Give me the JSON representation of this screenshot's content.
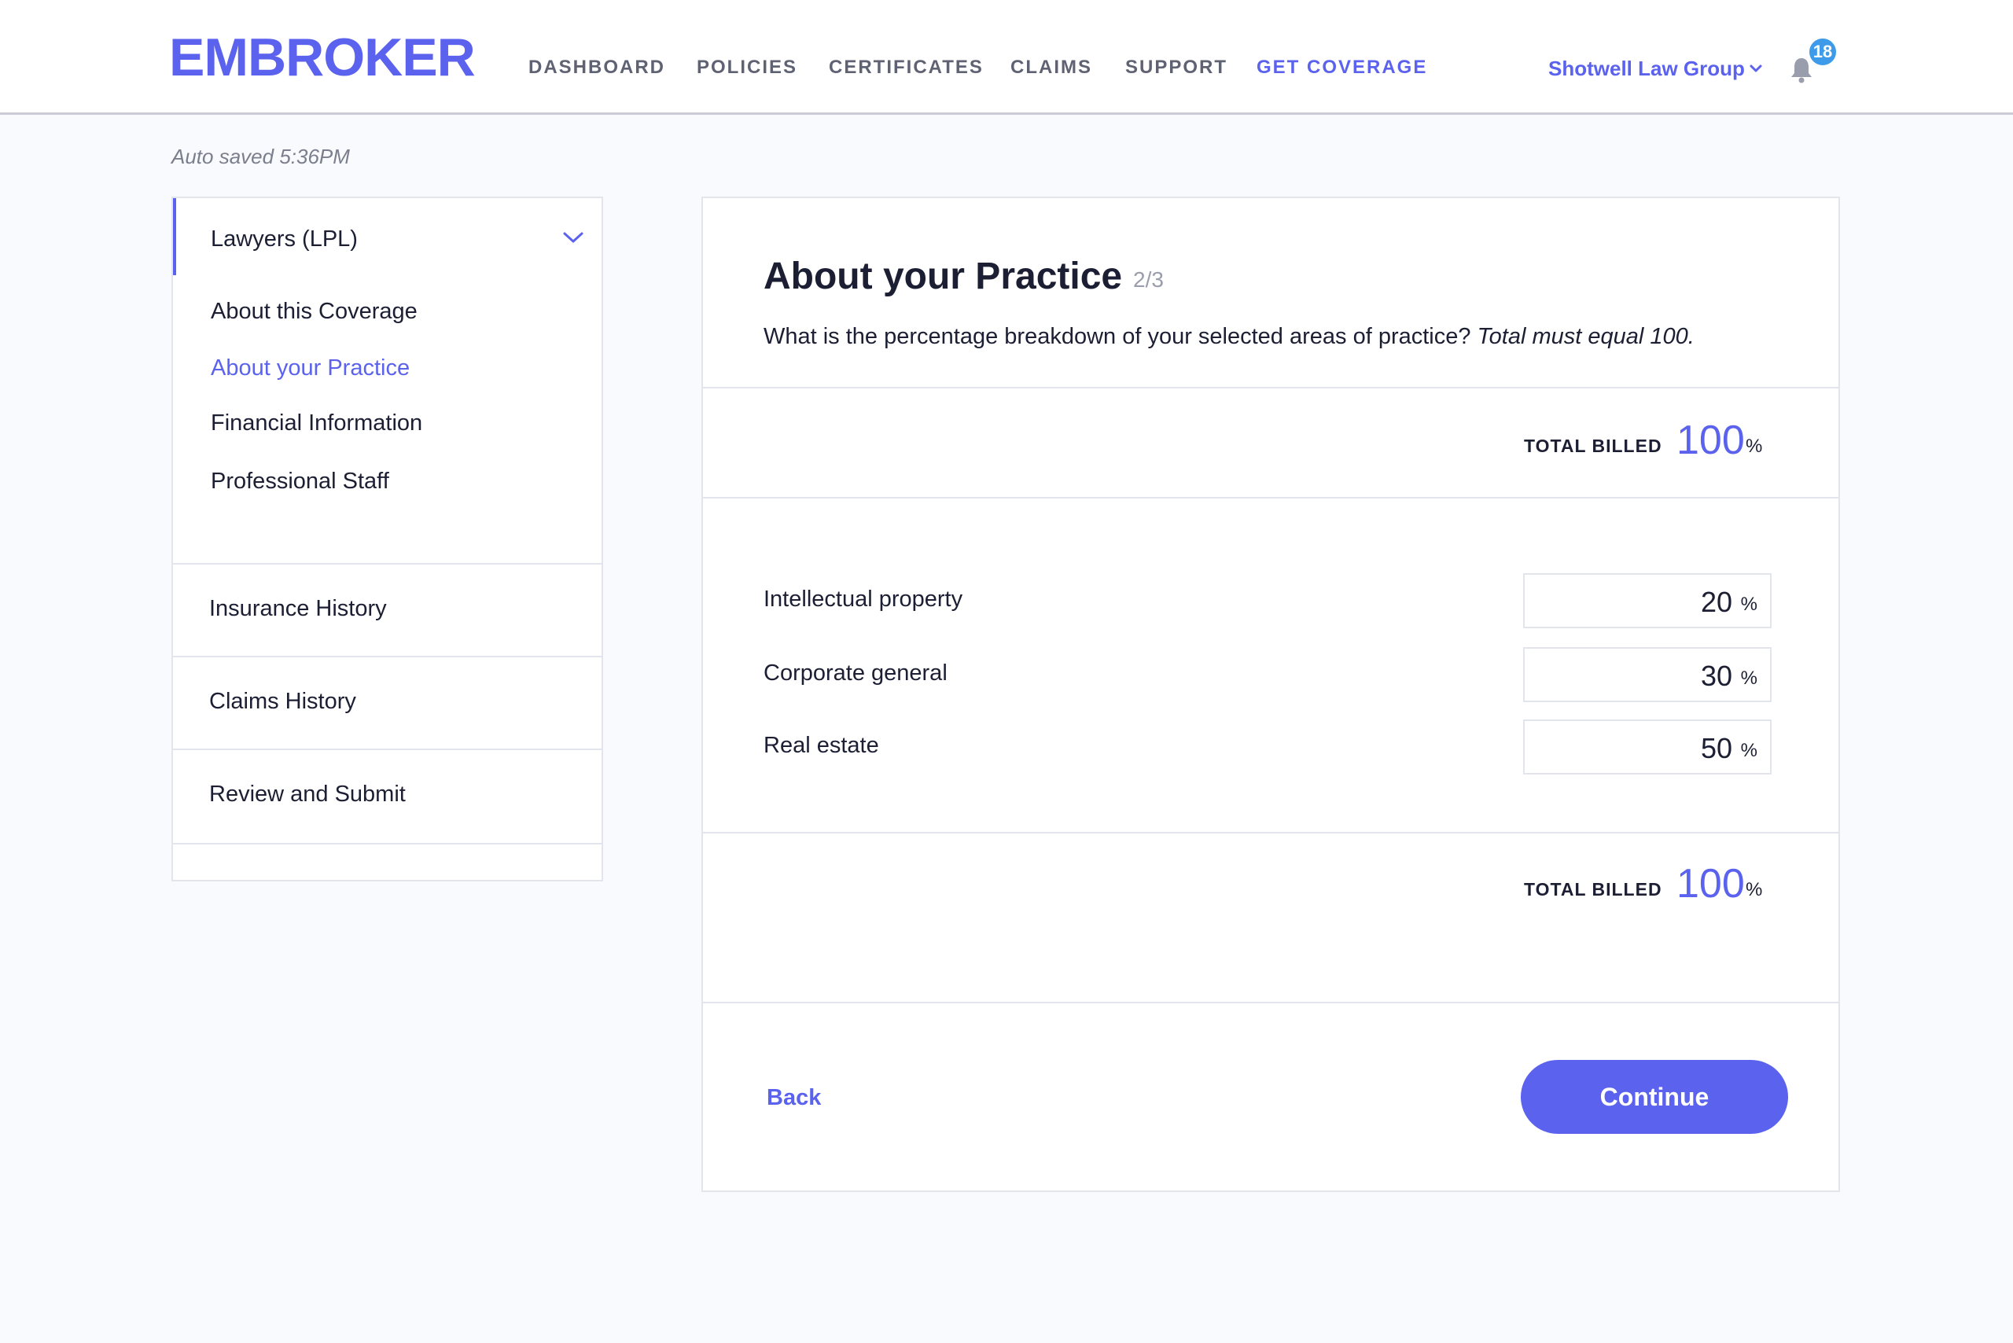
{
  "brand": {
    "logo": "EMBROKER",
    "accent": "#5b62ee"
  },
  "nav": {
    "items": [
      {
        "label": "DASHBOARD",
        "active": false
      },
      {
        "label": "POLICIES",
        "active": false
      },
      {
        "label": "CERTIFICATES",
        "active": false
      },
      {
        "label": "CLAIMS",
        "active": false
      },
      {
        "label": "SUPPORT",
        "active": false
      },
      {
        "label": "GET COVERAGE",
        "active": true
      }
    ],
    "account": "Shotwell Law Group",
    "notifications": "18"
  },
  "autosave": "Auto saved 5:36PM",
  "sidebar": {
    "section_title": "Lawyers (LPL)",
    "subitems": [
      {
        "label": "About this Coverage",
        "active": false
      },
      {
        "label": "About your Practice",
        "active": true
      },
      {
        "label": "Financial Information",
        "active": false
      },
      {
        "label": "Professional Staff",
        "active": false
      }
    ],
    "sections": [
      {
        "label": "Insurance History"
      },
      {
        "label": "Claims History"
      },
      {
        "label": "Review and Submit"
      }
    ]
  },
  "main": {
    "title": "About your Practice",
    "step": "2/3",
    "question": "What is the percentage breakdown of your selected areas of practice?",
    "question_note": "Total must equal 100.",
    "total_label": "TOTAL BILLED",
    "total_value": "100",
    "percent_sign": "%",
    "rows": [
      {
        "label": "Intellectual property",
        "value": "20"
      },
      {
        "label": "Corporate general",
        "value": "30"
      },
      {
        "label": "Real estate",
        "value": "50"
      }
    ],
    "back_label": "Back",
    "continue_label": "Continue"
  }
}
